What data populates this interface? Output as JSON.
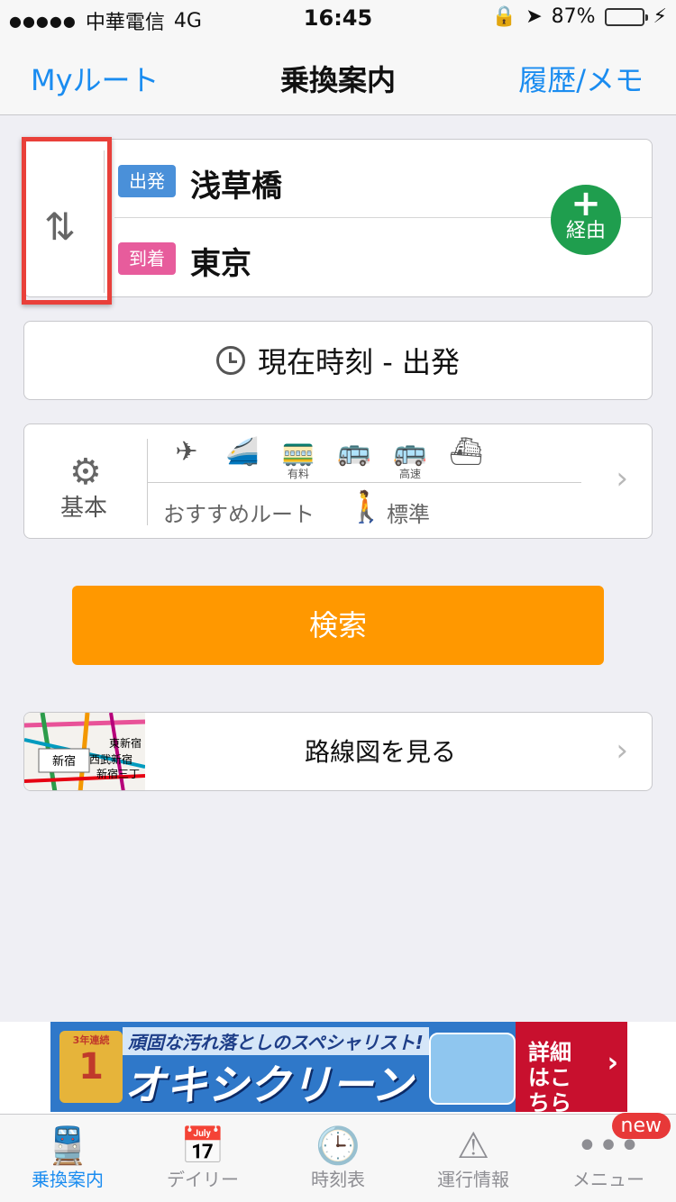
{
  "status": {
    "carrier": "中華電信",
    "network": "4G",
    "time": "16:45",
    "battery": "87%",
    "battery_fill": 0.87
  },
  "nav": {
    "left": "Myルート",
    "title": "乗換案内",
    "right": "履歴/メモ"
  },
  "station": {
    "departure_tag": "出発",
    "departure": "浅草橋",
    "arrival_tag": "到着",
    "arrival": "東京",
    "via_label": "経由"
  },
  "time_button": "現在時刻 - 出発",
  "settings": {
    "label": "基本",
    "modes": [
      {
        "icon": "plane-icon",
        "sub": ""
      },
      {
        "icon": "shinkansen-icon",
        "sub": ""
      },
      {
        "icon": "limited-express-icon",
        "sub": "有料"
      },
      {
        "icon": "bus-icon",
        "sub": ""
      },
      {
        "icon": "highway-bus-icon",
        "sub": "高速"
      },
      {
        "icon": "ferry-icon",
        "sub": ""
      }
    ],
    "route": "おすすめルート",
    "walk": "標準"
  },
  "search_button": "検索",
  "map": {
    "label": "路線図を見る",
    "stations": [
      "新宿",
      "東新宿",
      "西武新宿",
      "新宿三丁"
    ]
  },
  "ad": {
    "headline": "頑固な汚れ落としのスペシャリスト!",
    "brand": "オキシクリーン",
    "cta": "詳細はこちら",
    "badge": "1",
    "badge_label": "3年連続"
  },
  "tabs": [
    {
      "label": "乗換案内",
      "icon": "train-icon",
      "active": true
    },
    {
      "label": "デイリー",
      "icon": "day-calendar-icon"
    },
    {
      "label": "時刻表",
      "icon": "clock-icon"
    },
    {
      "label": "運行情報",
      "icon": "warning-icon"
    },
    {
      "label": "メニュー",
      "icon": "more-icon",
      "badge": "new"
    }
  ]
}
